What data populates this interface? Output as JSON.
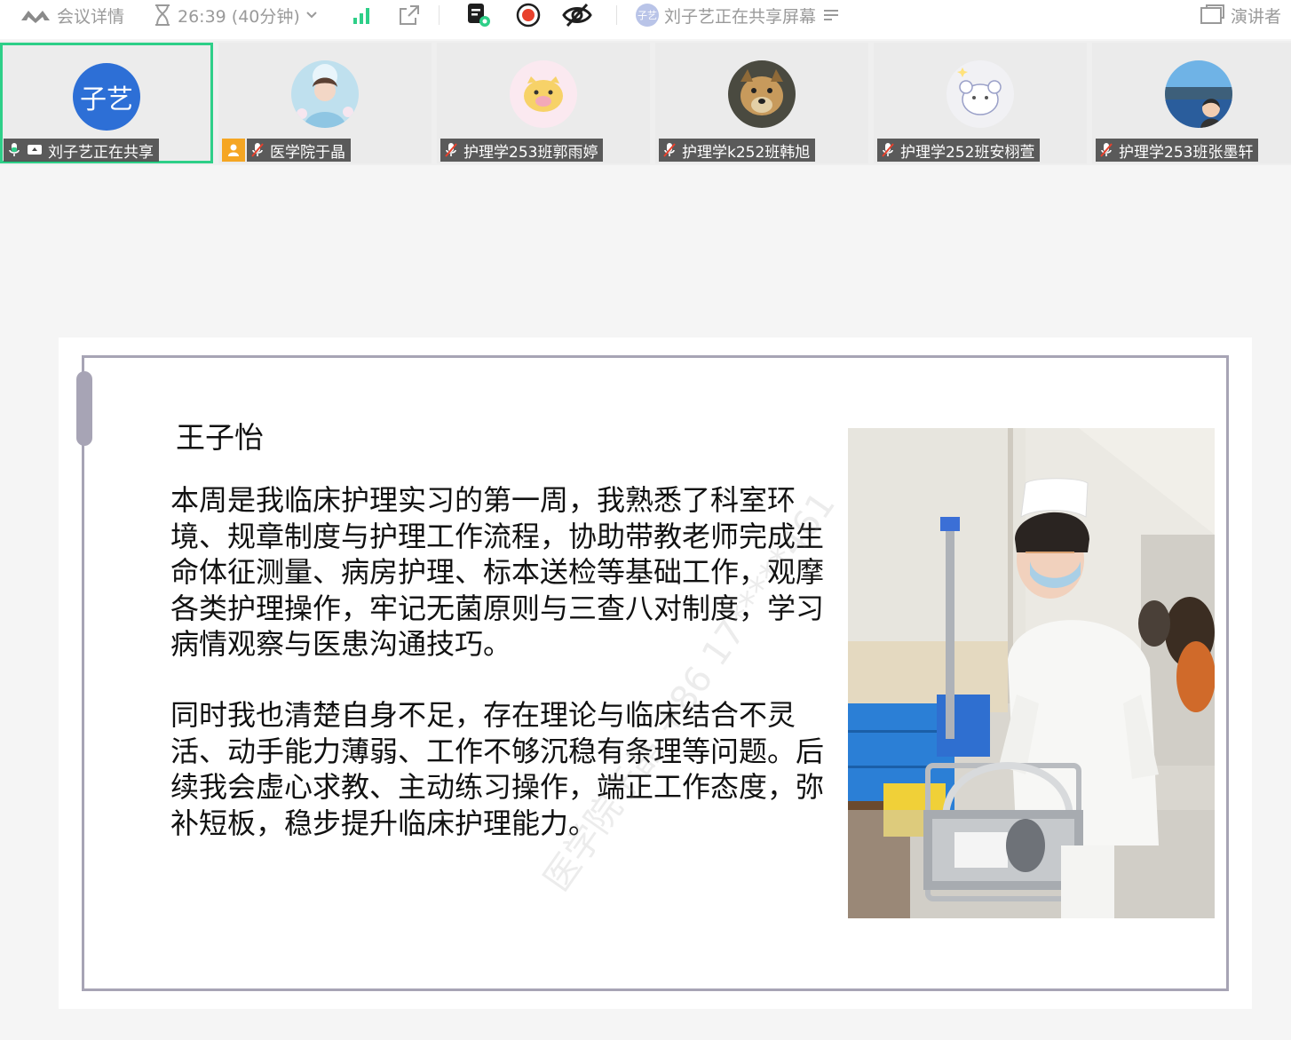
{
  "toolbar": {
    "meeting_details": "会议详情",
    "timer": "26:39 (40分钟)",
    "sharer_avatar_text": "子艺",
    "sharing_status": "刘子艺正在共享屏幕",
    "speaker_view": "演讲者"
  },
  "participants": [
    {
      "name": "刘子艺正在共享",
      "avatar_text": "子艺",
      "active": true
    },
    {
      "name": "医学院于晶",
      "host": true
    },
    {
      "name": "护理学253班郭雨婷"
    },
    {
      "name": "护理学k252班韩旭"
    },
    {
      "name": "护理学252班安栩萱"
    },
    {
      "name": "护理学253班张墨轩"
    }
  ],
  "slide": {
    "title": "王子怡",
    "para1": "本周是我临床护理实习的第一周，我熟悉了科室环境、规章制度与护理工作流程，协助带教老师完成生命体征测量、病房护理、标本送检等基础工作，观摩各类护理操作，牢记无菌原则与三查八对制度，学习病情观察与医患沟通技巧。",
    "para2": "同时我也清楚自身不足，存在理论与临床结合不灵活、动手能力薄弱、工作不够沉稳有条理等问题。后续我会虚心求教、主动练习操作，端正工作态度，弥补短板，稳步提升临床护理能力。",
    "watermark": "医学院于晶 +86 17*****461"
  },
  "colors": {
    "active_border": "#2ecf88",
    "avatar_blue": "#2d6fd6",
    "record_red": "#e8412c",
    "frame": "#a7a4b5"
  }
}
